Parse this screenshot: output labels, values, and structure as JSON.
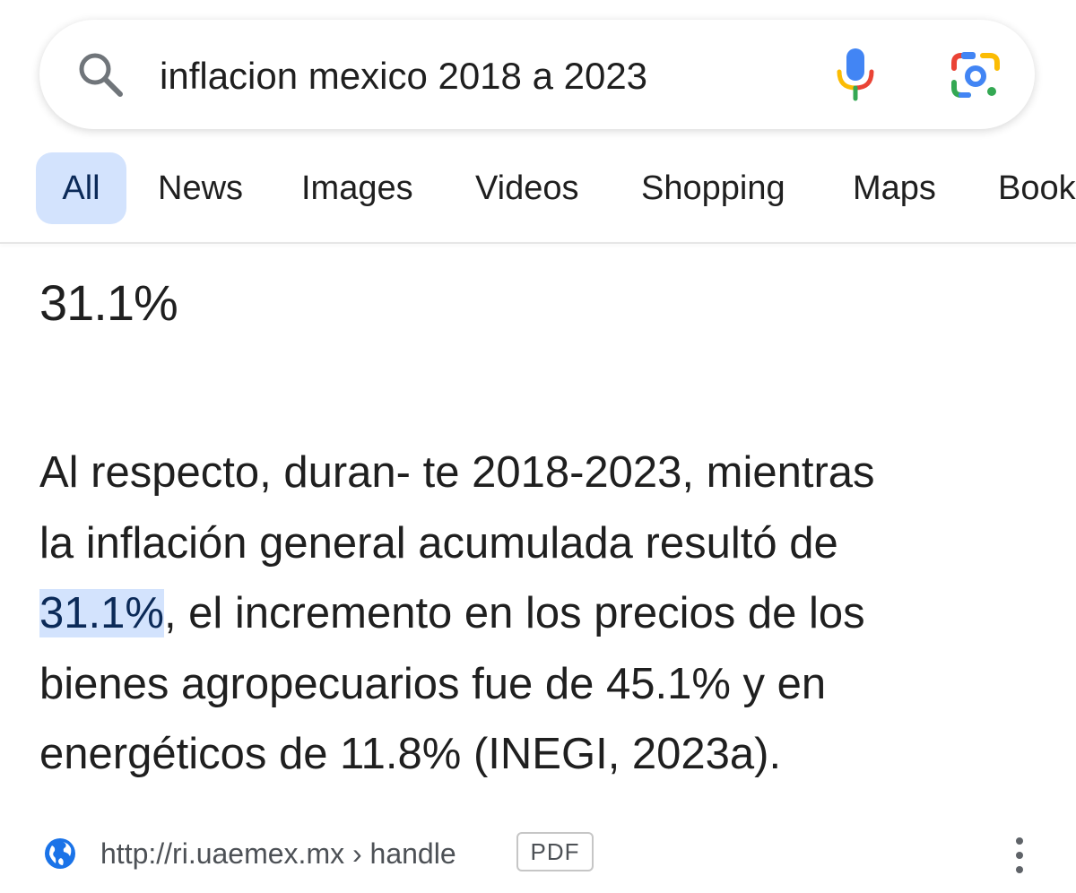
{
  "search": {
    "query": "inflacion mexico 2018 a 2023",
    "icons": {
      "search": "search-icon",
      "mic": "mic-icon",
      "lens": "google-lens-icon"
    }
  },
  "tabs": [
    {
      "label": "All",
      "active": true
    },
    {
      "label": "News",
      "active": false
    },
    {
      "label": "Images",
      "active": false
    },
    {
      "label": "Videos",
      "active": false
    },
    {
      "label": "Shopping",
      "active": false
    },
    {
      "label": "Maps",
      "active": false
    },
    {
      "label": "Book",
      "active": false
    }
  ],
  "result": {
    "answer": "31.1%",
    "snippet": {
      "line1": "Al respecto, duran- te 2018-2023, mientras",
      "line2": "la inflación general acumulada resultó de",
      "line3_highlight": "31.1%",
      "line3_rest": ", el incremento en los precios de los",
      "line4": "bienes agropecuarios fue de 45.1% y en",
      "line5": "energéticos de 11.8% (INEGI, 2023a)."
    },
    "source": {
      "url": "http://ri.uaemex.mx › handle",
      "badge": "PDF",
      "icons": {
        "site": "globe-icon",
        "more": "more-vert-icon"
      }
    }
  },
  "colors": {
    "highlight_bg": "#d3e3fd",
    "active_tab_bg": "#d3e3fd",
    "text": "#1f1f1f",
    "secondary_text": "#4d5156",
    "globe_blue": "#1a73e8"
  }
}
